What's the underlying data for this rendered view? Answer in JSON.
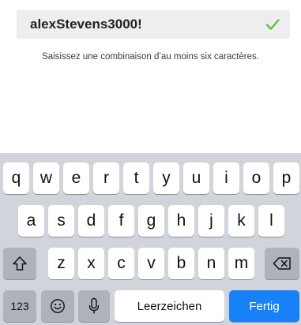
{
  "field": {
    "value": "alexStevens3000!",
    "status_icon": "checkmark-icon",
    "status_color": "#5cc335"
  },
  "hint": "Saisissez une combinaison d’au moins six caractères.",
  "keyboard": {
    "row1": [
      "q",
      "w",
      "e",
      "r",
      "t",
      "y",
      "u",
      "i",
      "o",
      "p"
    ],
    "row2": [
      "a",
      "s",
      "d",
      "f",
      "g",
      "h",
      "j",
      "k",
      "l"
    ],
    "row3": [
      "z",
      "x",
      "c",
      "v",
      "b",
      "n",
      "m"
    ],
    "shift_icon": "shift-icon",
    "backspace_icon": "backspace-icon",
    "numbers_label": "123",
    "emoji_icon": "emoji-icon",
    "mic_icon": "microphone-icon",
    "space_label": "Leerzeichen",
    "done_label": "Fertig",
    "done_color": "#1782f7"
  }
}
